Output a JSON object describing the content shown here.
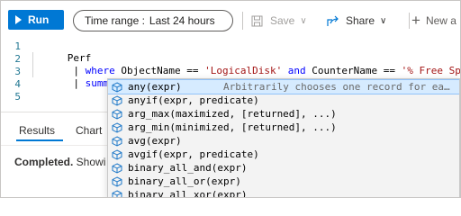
{
  "toolbar": {
    "run_label": "Run",
    "time_range_label": "Time range :",
    "time_range_value": "Last 24 hours",
    "save_label": "Save",
    "share_label": "Share",
    "new_label": "New a"
  },
  "editor": {
    "line_numbers": [
      "1",
      "2",
      "3",
      "4",
      "5"
    ],
    "line1": "Perf",
    "line2_kw1": "where",
    "line2_a": " ObjectName == ",
    "line2_str1": "'LogicalDisk'",
    "line2_kw2": " and",
    "line2_b": " CounterName == ",
    "line2_str2": "'% Free Spac",
    "line3_kw": "summarize"
  },
  "results": {
    "tabs": [
      "Results",
      "Chart"
    ],
    "status_bold": "Completed.",
    "status_text": " Showi"
  },
  "suggestions": {
    "selected_desc": "Arbitrarily chooses one record for ea…",
    "items": [
      "any(expr)",
      "anyif(expr, predicate)",
      "arg_max(maximized, [returned], ...)",
      "arg_min(minimized, [returned], ...)",
      "avg(expr)",
      "avgif(expr, predicate)",
      "binary_all_and(expr)",
      "binary_all_or(expr)",
      "binary_all_xor(expr)"
    ]
  },
  "colors": {
    "accent": "#0078d4",
    "keyword": "#0000ff",
    "string": "#a31515",
    "line_number": "#237893",
    "suggest_icon": "#1e78c8"
  }
}
